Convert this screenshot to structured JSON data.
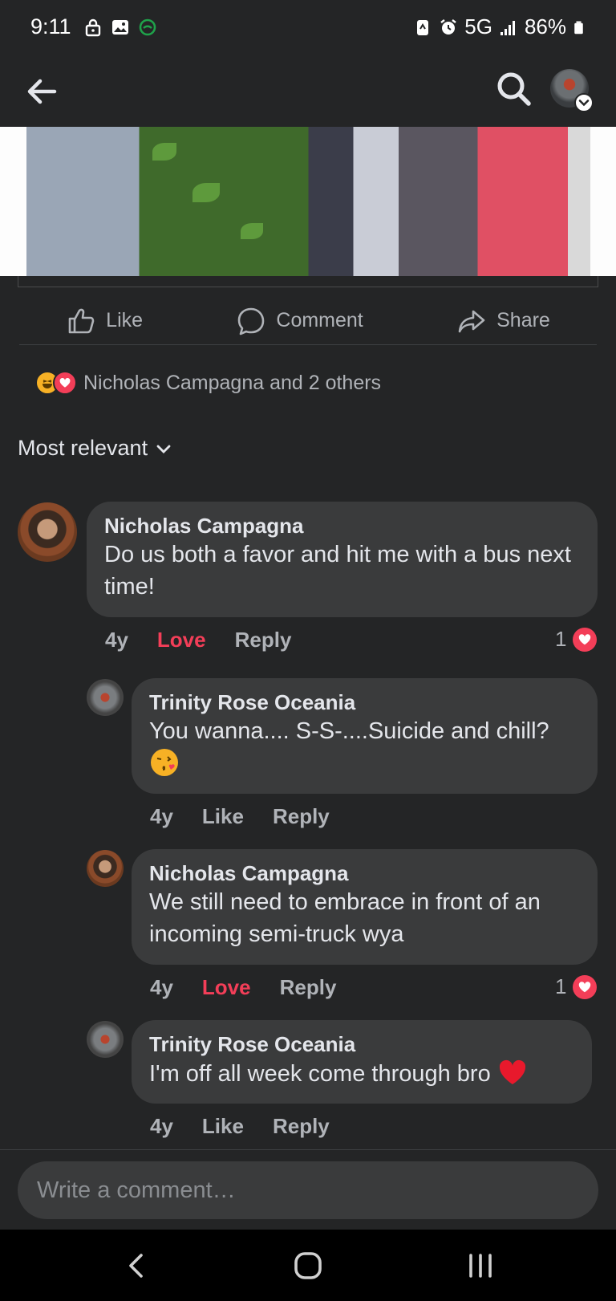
{
  "status_bar": {
    "time": "9:11",
    "network": "5G",
    "battery": "86%"
  },
  "post": {
    "actions": {
      "like": "Like",
      "comment": "Comment",
      "share": "Share"
    },
    "reactions_summary": "Nicholas Campagna and 2 others"
  },
  "sort_label": "Most relevant",
  "comments": [
    {
      "author": "Nicholas Campagna",
      "text": "Do us both a favor and hit me with a bus next time!",
      "time": "4y",
      "reaction_label": "Love",
      "reply_label": "Reply",
      "reaction_count": "1"
    },
    {
      "author": "Trinity Rose Oceania",
      "text": "You wanna.... S-S-....Suicide and chill?",
      "time": "4y",
      "reaction_label": "Like",
      "reply_label": "Reply"
    },
    {
      "author": "Nicholas Campagna",
      "text": "We still need to embrace in front of an incoming semi-truck wya",
      "time": "4y",
      "reaction_label": "Love",
      "reply_label": "Reply",
      "reaction_count": "1"
    },
    {
      "author": "Trinity Rose Oceania",
      "text": "I'm off all week come through bro",
      "time": "4y",
      "reaction_label": "Like",
      "reply_label": "Reply"
    }
  ],
  "comment_input": {
    "placeholder": "Write a comment…"
  },
  "icons": {
    "back": "arrow-left-icon",
    "search": "search-icon",
    "like": "thumbs-up-icon",
    "comment": "speech-bubble-icon",
    "share": "share-arrow-icon",
    "sort": "chevron-down-icon"
  },
  "colors": {
    "background": "#242526",
    "bubble": "#3a3b3c",
    "love": "#f33e58",
    "muted": "#b0b3b8"
  }
}
